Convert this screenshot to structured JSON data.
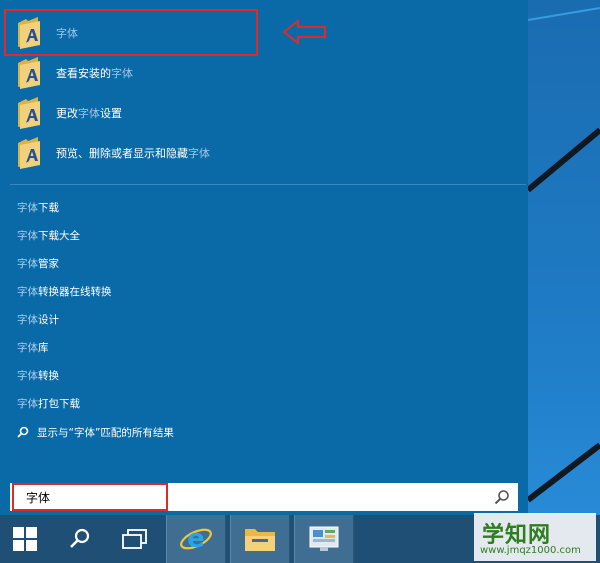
{
  "results": {
    "apps": [
      {
        "pre": "",
        "hl": "",
        "post": "字体"
      },
      {
        "pre": "查看安装的",
        "hl": "字体",
        "post": ""
      },
      {
        "pre": "更改",
        "hl": "字体",
        "post": "设置"
      },
      {
        "pre": "预览、删除或者显示和隐藏",
        "hl": "字体",
        "post": ""
      }
    ],
    "suggestions": [
      {
        "hl": "字体",
        "post": "下载"
      },
      {
        "hl": "字体",
        "post": "下载大全"
      },
      {
        "hl": "字体",
        "post": "管家"
      },
      {
        "hl": "字体",
        "post": "转换器在线转换"
      },
      {
        "hl": "字体",
        "post": "设计"
      },
      {
        "hl": "字体",
        "post": "库"
      },
      {
        "hl": "字体",
        "post": "转换"
      },
      {
        "hl": "字体",
        "post": "打包下载"
      }
    ],
    "show_all": "显示与“字体”匹配的所有结果"
  },
  "search": {
    "value": "字体"
  },
  "watermark": {
    "title": "学知网",
    "url": "www.jmqz1000.com"
  },
  "colors": {
    "panel": "#0a6aa8",
    "highlight": "#e02a2a",
    "taskbar": "#1f4f74"
  }
}
